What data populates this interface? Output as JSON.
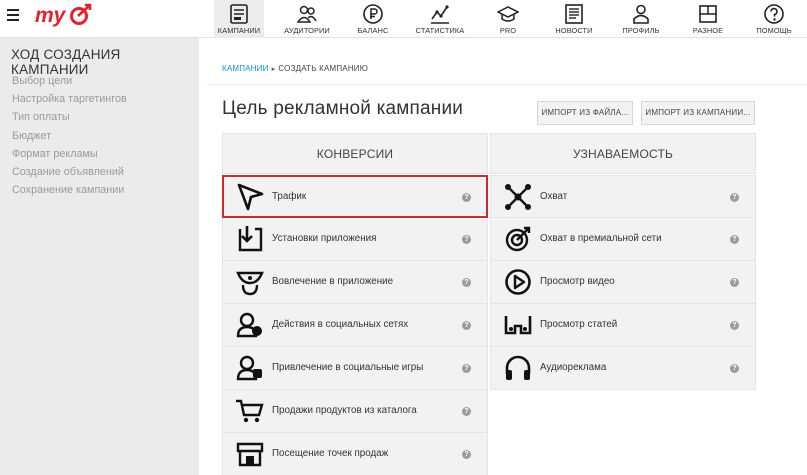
{
  "logo": {
    "text": "my"
  },
  "nav": [
    {
      "key": "campaigns",
      "label": "КАМПАНИИ",
      "icon": "campaigns-icon",
      "active": true
    },
    {
      "key": "audiences",
      "label": "АУДИТОРИИ",
      "icon": "audiences-icon"
    },
    {
      "key": "balance",
      "label": "БАЛАНС",
      "icon": "balance-icon"
    },
    {
      "key": "stats",
      "label": "СТАТИСТИКА",
      "icon": "statistics-icon"
    },
    {
      "key": "pro",
      "label": "PRO",
      "icon": "pro-icon"
    },
    {
      "key": "news",
      "label": "НОВОСТИ",
      "icon": "news-icon"
    },
    {
      "key": "profile",
      "label": "ПРОФИЛЬ",
      "icon": "profile-icon"
    },
    {
      "key": "misc",
      "label": "РАЗНОЕ",
      "icon": "misc-icon"
    },
    {
      "key": "help",
      "label": "ПОМОЩЬ",
      "icon": "help-icon"
    }
  ],
  "sidebar": {
    "title": "ХОД СОЗДАНИЯ КАМПАНИИ",
    "steps": [
      "Выбор цели",
      "Настройка таргетингов",
      "Тип оплаты",
      "Бюджет",
      "Формат рекламы",
      "Создание объявлений",
      "Сохранение кампании"
    ]
  },
  "breadcrumb": {
    "link": "КАМПАНИИ",
    "separator": "▸",
    "current": "СОЗДАТЬ КАМПАНИЮ"
  },
  "page_title": "Цель рекламной кампании",
  "buttons": {
    "import_file": "ИМПОРТ ИЗ ФАЙЛА...",
    "import_campaign": "ИМПОРТ ИЗ КАМПАНИИ..."
  },
  "help_glyph": "?",
  "conversions": {
    "title": "КОНВЕРСИИ",
    "options": [
      {
        "label": "Трафик",
        "icon": "cursor-icon",
        "highlighted": true
      },
      {
        "label": "Установки приложения",
        "icon": "app-install-icon"
      },
      {
        "label": "Вовлечение в приложение",
        "icon": "app-engagement-icon"
      },
      {
        "label": "Действия в социальных сетях",
        "icon": "social-actions-icon"
      },
      {
        "label": "Привлечение в социальные игры",
        "icon": "social-games-icon"
      },
      {
        "label": "Продажи продуктов из каталога",
        "icon": "cart-icon"
      },
      {
        "label": "Посещение точек продаж",
        "icon": "store-icon"
      }
    ]
  },
  "awareness": {
    "title": "УЗНАВАЕМОСТЬ",
    "options": [
      {
        "label": "Охват",
        "icon": "reach-icon"
      },
      {
        "label": "Охват в премиальной сети",
        "icon": "premium-reach-icon"
      },
      {
        "label": "Просмотр видео",
        "icon": "video-play-icon"
      },
      {
        "label": "Просмотр статей",
        "icon": "article-glasses-icon"
      },
      {
        "label": "Аудиореклама",
        "icon": "headphones-icon"
      }
    ]
  },
  "colors": {
    "brand_red": "#e8202a",
    "highlight_red": "#d12a26",
    "link_blue": "#168de2"
  }
}
